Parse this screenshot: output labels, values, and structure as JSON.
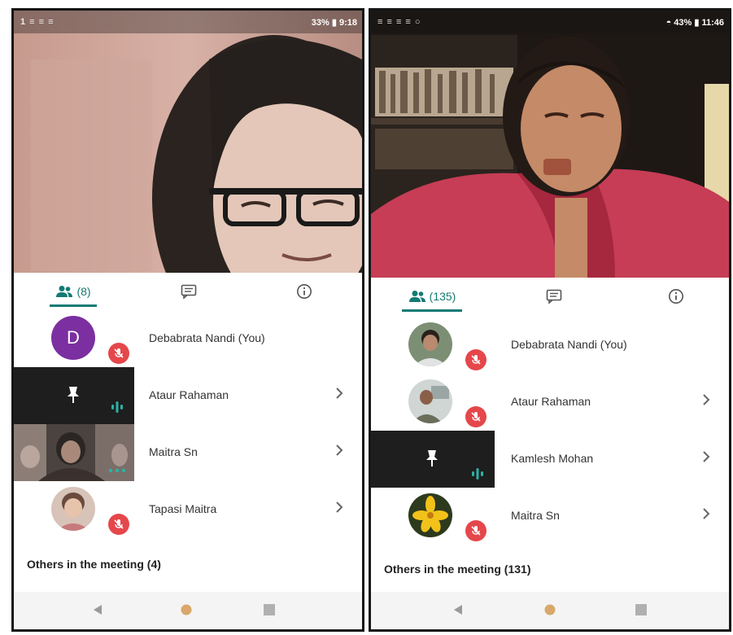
{
  "screens": [
    {
      "status_bar": {
        "left": "1 ≡ ≡ ≡",
        "right": "33% ▮ 9:18"
      },
      "tabs": {
        "people_count": "(8)"
      },
      "participants": [
        {
          "name": "Debabrata Nandi (You)",
          "avatar_letter": "D"
        },
        {
          "name": "Ataur Rahaman"
        },
        {
          "name": "Maitra Sn"
        },
        {
          "name": "Tapasi Maitra"
        }
      ],
      "others_label": "Others in the meeting (4)"
    },
    {
      "status_bar": {
        "left": "≡ ≡ ≡ ≡ ○",
        "right": "◓ 43% ▮ 11:46"
      },
      "tabs": {
        "people_count": "(135)"
      },
      "participants": [
        {
          "name": "Debabrata Nandi (You)"
        },
        {
          "name": "Ataur Rahaman"
        },
        {
          "name": "Kamlesh Mohan"
        },
        {
          "name": "Maitra Sn"
        }
      ],
      "others_label": "Others in the meeting (131)"
    }
  ],
  "colors": {
    "accent": "#137a74",
    "mute_red": "#e5474b",
    "avatar_purple": "#7b2fa0",
    "tile_dark": "#1e1e1e",
    "speaking_teal": "#2ab3a6"
  },
  "icons": [
    "people-icon",
    "chat-icon",
    "info-icon",
    "mic-off-icon",
    "pin-icon",
    "audio-bars-icon",
    "more-dots-icon",
    "chevron-right-icon",
    "back-icon",
    "home-icon",
    "recents-icon"
  ]
}
